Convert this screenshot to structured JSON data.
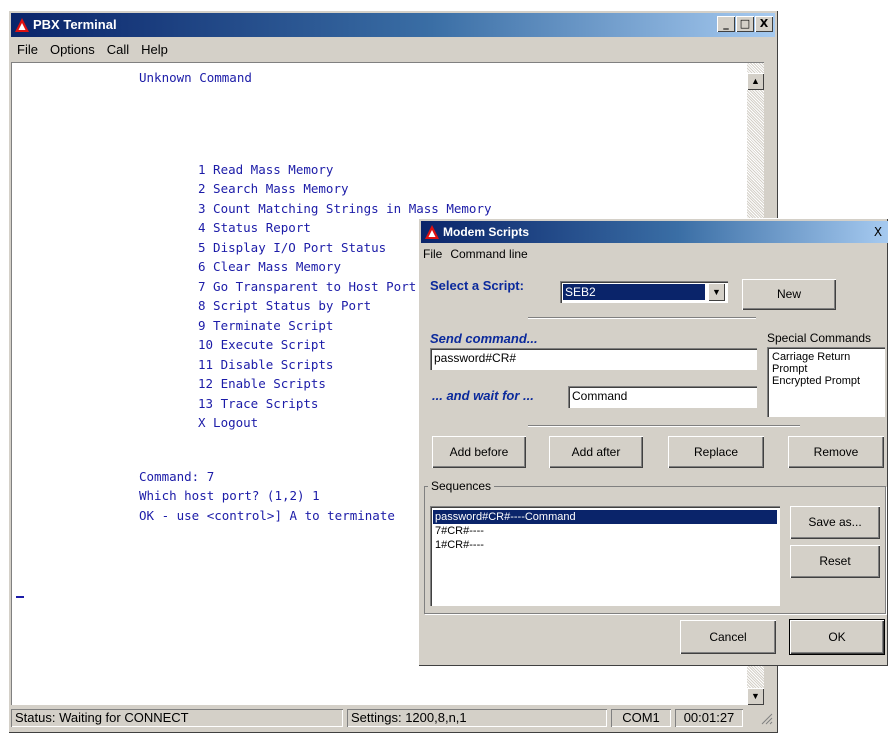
{
  "main_window": {
    "title": "PBX Terminal",
    "controls": {
      "minimize": "_",
      "maximize": "□",
      "close": "X"
    },
    "menu": [
      "File",
      "Options",
      "Call",
      "Help"
    ]
  },
  "terminal": {
    "lines": [
      "Unknown Command",
      "1 Read Mass Memory",
      "2 Search Mass Memory",
      "3 Count Matching Strings in Mass Memory",
      "4 Status Report",
      "5 Display I/O Port Status",
      "6 Clear Mass Memory",
      "7 Go Transparent to Host Port",
      "8 Script Status by Port",
      "9 Terminate Script",
      "10 Execute Script",
      "11 Disable Scripts",
      "12 Enable Scripts",
      "13 Trace Scripts",
      "X Logout",
      "Command: 7",
      "Which host port? (1,2) 1",
      "OK - use <control>] A to terminate"
    ]
  },
  "statusbar": {
    "status": "Status: Waiting for CONNECT",
    "settings": "Settings: 1200,8,n,1",
    "port": "COM1",
    "time": "00:01:27"
  },
  "dialog": {
    "title": "Modem Scripts",
    "close": "X",
    "menu": [
      "File",
      "Command line"
    ],
    "select_label": "Select a Script:",
    "selected_script": "SEB2",
    "new_button": "New",
    "send_label": "Send command...",
    "send_value": "password#CR#",
    "wait_label": "... and wait for ...",
    "wait_value": "Command",
    "special_label": "Special Commands",
    "special_items": [
      "Carriage Return",
      "Prompt",
      "Encrypted Prompt"
    ],
    "buttons": {
      "add_before": "Add before",
      "add_after": "Add after",
      "replace": "Replace",
      "remove": "Remove",
      "save_as": "Save as...",
      "reset": "Reset",
      "cancel": "Cancel",
      "ok": "OK"
    },
    "sequences_label": "Sequences",
    "sequences": [
      "password#CR#----Command",
      "7#CR#----",
      "1#CR#----"
    ]
  }
}
